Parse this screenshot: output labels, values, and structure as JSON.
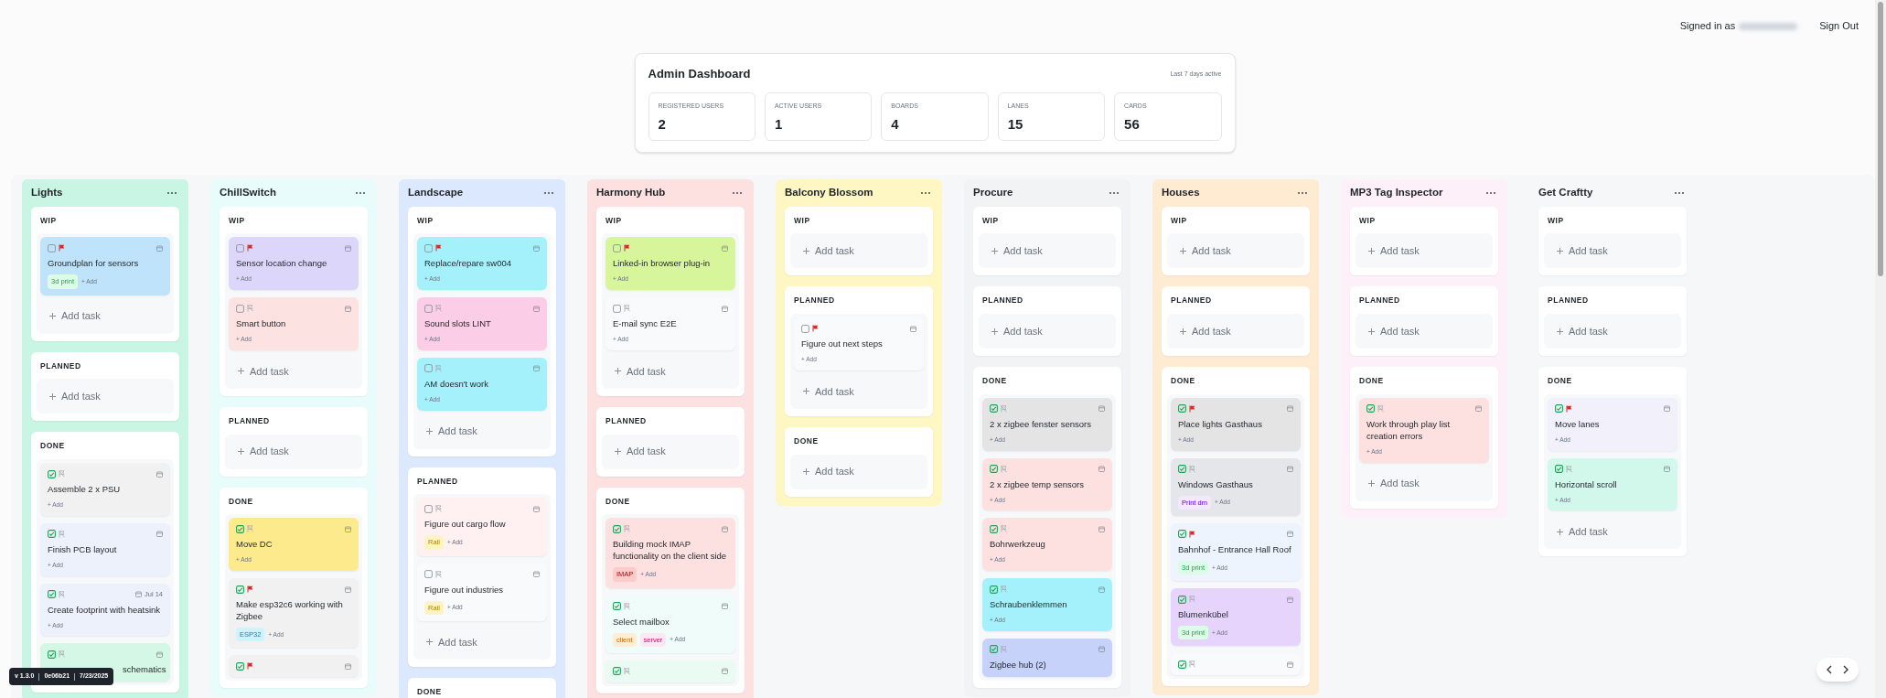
{
  "account": {
    "label": "Signed in as",
    "sign_out": "Sign Out"
  },
  "dashboard": {
    "title": "Admin Dashboard",
    "note": "Last 7 days active",
    "stats": [
      {
        "label": "REGISTERED USERS",
        "value": "2"
      },
      {
        "label": "ACTIVE USERS",
        "value": "1"
      },
      {
        "label": "BOARDS",
        "value": "4"
      },
      {
        "label": "LANES",
        "value": "15"
      },
      {
        "label": "CARDS",
        "value": "56"
      }
    ]
  },
  "columns": [
    {
      "title": "Lights",
      "color": "#c9f5e4",
      "lanes": [
        {
          "title": "WIP",
          "add_task": "Add task",
          "cards": [
            {
              "title": "Groundplan for sensors",
              "done": false,
              "flagged": true,
              "color": "#bfe3fb",
              "tags": [
                {
                  "label": "3d print",
                  "color": "#dcfce7"
                }
              ],
              "add": "+ Add"
            }
          ]
        },
        {
          "title": "PLANNED",
          "add_task": "Add task"
        },
        {
          "title": "DONE",
          "cards": [
            {
              "title": "Assemble 2 x PSU",
              "done": true,
              "flagged": false,
              "color": "#f1f1f1",
              "add": "+ Add"
            },
            {
              "title": "Finish PCB layout",
              "done": true,
              "flagged": false,
              "color": "#edf1fb",
              "add": "+ Add"
            },
            {
              "title": "Create footprint with heatsink",
              "done": true,
              "flagged": false,
              "color": "#edf1fb",
              "date": "Jul 14",
              "add": "+ Add"
            },
            {
              "title": "schematics",
              "done": true,
              "flagged": false,
              "color": "#d4f7e6"
            }
          ]
        }
      ]
    },
    {
      "title": "ChillSwitch",
      "color": "#e9fcfc",
      "lanes": [
        {
          "title": "WIP",
          "add_task": "Add task",
          "cards": [
            {
              "title": "Sensor location change",
              "done": false,
              "flagged": true,
              "color": "#ddd6fb",
              "add": "+ Add"
            },
            {
              "title": "Smart button",
              "done": false,
              "flagged": false,
              "color": "#fde2e2",
              "add": "+ Add"
            }
          ]
        },
        {
          "title": "PLANNED",
          "add_task": "Add task"
        },
        {
          "title": "DONE",
          "cards": [
            {
              "title": "Move DC",
              "done": true,
              "flagged": false,
              "color": "#fdea8c",
              "add": "+ Add"
            },
            {
              "title": "Make esp32c6 working with Zigbee",
              "done": true,
              "flagged": true,
              "color": "#f1f1f1",
              "tags": [
                {
                  "label": "ESP32",
                  "color": "#cff3fa"
                }
              ],
              "add": "+ Add"
            },
            {
              "done": true,
              "flagged": true,
              "color": "#f1f1f1"
            }
          ]
        }
      ]
    },
    {
      "title": "Landscape",
      "color": "#dbe8fd",
      "lanes": [
        {
          "title": "WIP",
          "add_task": "Add task",
          "cards": [
            {
              "title": "Replace/repare sw004",
              "done": false,
              "flagged": true,
              "color": "#a5f1fb",
              "add": "+ Add"
            },
            {
              "title": "Sound slots LINT",
              "done": false,
              "flagged": false,
              "color": "#fbcde6",
              "add": "+ Add"
            },
            {
              "title": "AM doesn't work",
              "done": false,
              "flagged": false,
              "color": "#a5f1fb",
              "add": "+ Add"
            }
          ]
        },
        {
          "title": "PLANNED",
          "add_task": "Add task",
          "cards": [
            {
              "title": "Figure out cargo flow",
              "done": false,
              "flagged": false,
              "color": "#fff1f1",
              "tags": [
                {
                  "label": "Rail",
                  "color": "#fef3c7"
                }
              ],
              "add": "+ Add"
            },
            {
              "title": "Figure out industries",
              "done": false,
              "flagged": false,
              "color": "#f9fafb",
              "tags": [
                {
                  "label": "Rail",
                  "color": "#fef3c7"
                }
              ],
              "add": "+ Add"
            }
          ]
        },
        {
          "title": "DONE"
        }
      ]
    },
    {
      "title": "Harmony Hub",
      "color": "#fde0e0",
      "lanes": [
        {
          "title": "WIP",
          "add_task": "Add task",
          "cards": [
            {
              "title": "Linked-in browser plug-in",
              "done": false,
              "flagged": true,
              "color": "#d7f59a",
              "add": "+ Add"
            },
            {
              "title": "E-mail sync E2E",
              "done": false,
              "flagged": false,
              "color": "#f9fafb",
              "add": "+ Add"
            }
          ]
        },
        {
          "title": "PLANNED",
          "add_task": "Add task"
        },
        {
          "title": "DONE",
          "cards": [
            {
              "title": "Building mock IMAP functionality on the client side",
              "done": true,
              "flagged": false,
              "color": "#fde1e1",
              "tags": [
                {
                  "label": "IMAP",
                  "color": "#fecaca"
                }
              ],
              "add": "+ Add"
            },
            {
              "title": "Select mailbox",
              "done": true,
              "flagged": false,
              "color": "#effcfa",
              "tags": [
                {
                  "label": "client",
                  "color": "#ffedd5"
                },
                {
                  "label": "server",
                  "color": "#fce7f3"
                }
              ],
              "add": "+ Add"
            },
            {
              "done": true,
              "flagged": false,
              "color": "#e9fbf2"
            }
          ]
        }
      ]
    },
    {
      "title": "Balcony Blossom",
      "color": "#fef7c4",
      "lanes": [
        {
          "title": "WIP",
          "add_task": "Add task"
        },
        {
          "title": "PLANNED",
          "add_task": "Add task",
          "cards": [
            {
              "title": "Figure out next steps",
              "done": false,
              "flagged": true,
              "color": "#f9fafb",
              "add": "+ Add"
            }
          ]
        },
        {
          "title": "DONE",
          "add_task": "Add task"
        }
      ]
    },
    {
      "title": "Procure",
      "color": "#f2f3f5",
      "lanes": [
        {
          "title": "WIP",
          "add_task": "Add task"
        },
        {
          "title": "PLANNED",
          "add_task": "Add task"
        },
        {
          "title": "DONE",
          "cards": [
            {
              "title": "2 x zigbee fenster sensors",
              "done": true,
              "flagged": false,
              "color": "#e4e4e4",
              "add": "+ Add"
            },
            {
              "title": "2 x zigbee temp sensors",
              "done": true,
              "flagged": false,
              "color": "#fde1e1",
              "add": "+ Add"
            },
            {
              "title": "Bohrwerkzeug",
              "done": true,
              "flagged": false,
              "color": "#fde1e1",
              "add": "+ Add"
            },
            {
              "title": "Schraubenklemmen",
              "done": true,
              "flagged": false,
              "color": "#a5f1fb",
              "add": "+ Add"
            },
            {
              "title": "Zigbee hub (2)",
              "done": true,
              "flagged": false,
              "color": "#c7d2fb"
            }
          ]
        }
      ]
    },
    {
      "title": "Houses",
      "color": "#feebd2",
      "lanes": [
        {
          "title": "WIP",
          "add_task": "Add task"
        },
        {
          "title": "PLANNED",
          "add_task": "Add task"
        },
        {
          "title": "DONE",
          "cards": [
            {
              "title": "Place lights Gasthaus",
              "done": true,
              "flagged": true,
              "color": "#e4e4e4",
              "add": "+ Add"
            },
            {
              "title": "Windows Gasthaus",
              "done": true,
              "flagged": false,
              "color": "#e4e6ea",
              "tags": [
                {
                  "label": "Print dm",
                  "color": "#f3e8ff"
                }
              ],
              "add": "+ Add"
            },
            {
              "title": "Bahnhof - Entrance Hall Roof",
              "done": true,
              "flagged": true,
              "color": "#eef4fe",
              "tags": [
                {
                  "label": "3d print",
                  "color": "#dcfce7"
                }
              ],
              "add": "+ Add"
            },
            {
              "title": "Blumenkübel",
              "done": true,
              "flagged": false,
              "color": "#e7d4fd",
              "tags": [
                {
                  "label": "3d print",
                  "color": "#dcfce7"
                }
              ],
              "add": "+ Add"
            },
            {
              "done": true,
              "flagged": false,
              "color": "#f9fafb"
            }
          ]
        }
      ]
    },
    {
      "title": "MP3 Tag Inspector",
      "color": "#fdf0f8",
      "lanes": [
        {
          "title": "WIP",
          "add_task": "Add task"
        },
        {
          "title": "PLANNED",
          "add_task": "Add task"
        },
        {
          "title": "DONE",
          "add_task": "Add task",
          "cards": [
            {
              "title": "Work through play list creation errors",
              "done": true,
              "flagged": false,
              "color": "#fde1e1",
              "add": "+ Add"
            }
          ]
        }
      ]
    },
    {
      "title": "Get Craftty",
      "lanes": [
        {
          "title": "WIP",
          "add_task": "Add task"
        },
        {
          "title": "PLANNED",
          "add_task": "Add task"
        },
        {
          "title": "DONE",
          "add_task": "Add task",
          "cards": [
            {
              "title": "Move lanes",
              "done": true,
              "flagged": true,
              "color": "#f1f0fb",
              "add": "+ Add"
            },
            {
              "title": "Horizontal scroll",
              "done": true,
              "flagged": false,
              "color": "#d1f8ea",
              "add": "+ Add"
            }
          ]
        }
      ]
    }
  ],
  "version": [
    "v 1.3.0",
    "0e06b21",
    "7/23/2025"
  ]
}
